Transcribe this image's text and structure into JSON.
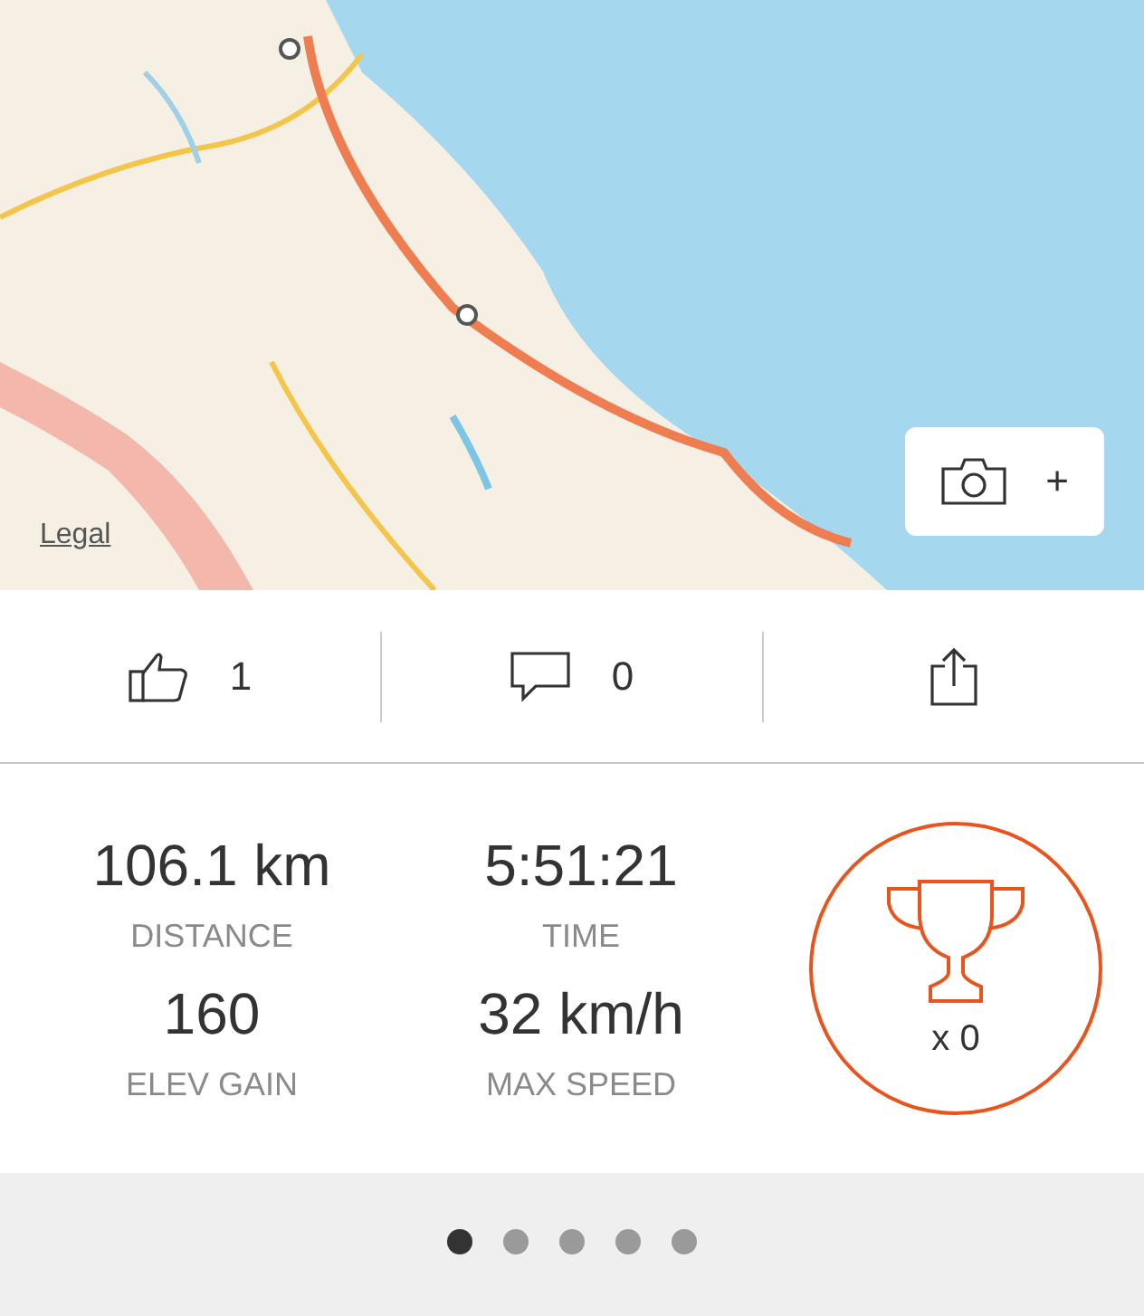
{
  "map": {
    "legal_link": "Legal",
    "photo_button": {
      "label": "+"
    }
  },
  "actions": [
    {
      "kind": "like",
      "count": "1"
    },
    {
      "kind": "comment",
      "count": "0"
    },
    {
      "kind": "share"
    }
  ],
  "stats": [
    {
      "value": "106.1 km",
      "label": "DISTANCE"
    },
    {
      "value": "5:51:21",
      "label": "TIME"
    },
    {
      "value": "160",
      "label": "ELEV GAIN"
    },
    {
      "value": "32 km/h",
      "label": "MAX SPEED"
    }
  ],
  "achievements": {
    "count": "x 0"
  },
  "pages": [
    {
      "selected": true
    },
    {
      "selected": false
    },
    {
      "selected": false
    },
    {
      "selected": false
    },
    {
      "selected": false
    }
  ]
}
